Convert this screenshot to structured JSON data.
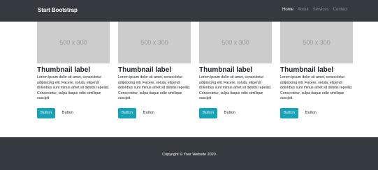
{
  "navbar": {
    "brand": "Start Bootstrap",
    "links": [
      "Home",
      "About",
      "Services",
      "Contact"
    ]
  },
  "cards": [
    {
      "thumb_text": "500 x 300",
      "title": "Thumbnail label",
      "text": "Lorem ipsum dolor sit amet, consectetur adipisicing elit. Facere, soluta, eligendi doloribus sunt minus amet sit debitis repellat. Consectetur, culpa itaque odio similique suscipit",
      "primary_button": "Button",
      "secondary_button": "Button"
    },
    {
      "thumb_text": "500 x 300",
      "title": "Thumbnail label",
      "text": "Lorem ipsum dolor sit amet, consectetur adipisicing elit. Facere, soluta, eligendi doloribus sunt minus amet sit debitis repellat. Consectetur, culpa itaque odio similique suscipit",
      "primary_button": "Button",
      "secondary_button": "Button"
    },
    {
      "thumb_text": "500 x 300",
      "title": "Thumbnail label",
      "text": "Lorem ipsum dolor sit amet, consectetur adipisicing elit. Facere, soluta, eligendi doloribus sunt minus amet sit debitis repellat. Consectetur, culpa itaque odio similique suscipit",
      "primary_button": "Button",
      "secondary_button": "Button"
    },
    {
      "thumb_text": "500 x 300",
      "title": "Thumbnail label",
      "text": "Lorem ipsum dolor sit amet, consectetur adipisicing elit. Facere, soluta, eligendi doloribus sunt minus amet sit debitis repellat. Consectetur, culpa itaque odio similique suscipit",
      "primary_button": "Button",
      "secondary_button": "Button"
    }
  ],
  "footer": {
    "copyright": "Copyright © Your Website 2020"
  },
  "colors": {
    "navbar_bg": "#343a40",
    "accent": "#17a2b8",
    "placeholder_bg": "#cccccc"
  }
}
